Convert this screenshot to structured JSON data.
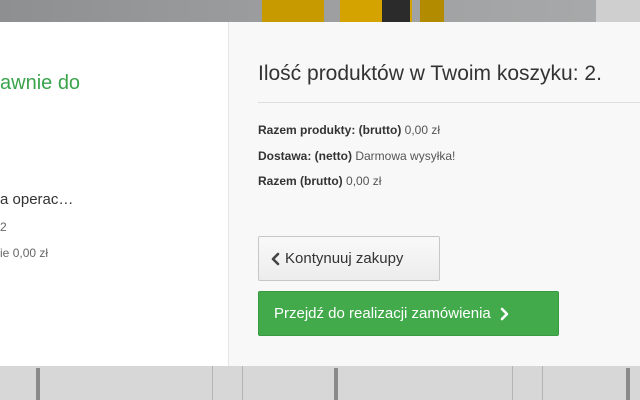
{
  "left_panel": {
    "heading_partial": "awnie do",
    "product_name_partial": "a operac…",
    "quantity_partial": "2",
    "total_partial_label": "ie",
    "total_partial_value": "0,00 zł"
  },
  "cart": {
    "count_text": "Ilość produktów w Twoim koszyku: 2.",
    "rows": [
      {
        "label": "Razem produkty: (brutto)",
        "value": "0,00 zł"
      },
      {
        "label": "Dostawa: (netto)",
        "value": "Darmowa wysyłka!"
      },
      {
        "label": "Razem (brutto)",
        "value": "0,00 zł"
      }
    ]
  },
  "buttons": {
    "continue_label": "Kontynuuj zakupy",
    "checkout_label": "Przejdź do realizacji zamówienia"
  },
  "colors": {
    "accent_green": "#43aa4c",
    "heading_green": "#3aa44b"
  },
  "icons": {
    "continue": "chevron-left-icon",
    "checkout": "chevron-right-icon"
  }
}
